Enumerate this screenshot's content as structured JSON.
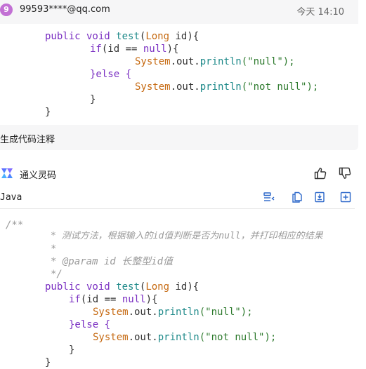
{
  "message": {
    "avatar_text": "9",
    "email": "99593****@qq.com",
    "timestamp": "今天 14:10",
    "prompt": "生成代码注释"
  },
  "assistant": {
    "name": "通义灵码"
  },
  "code_block": {
    "language": "Java"
  },
  "user_code": [
    [
      "public void ",
      "test",
      "(",
      "Long",
      " id){"
    ],
    [
      "if",
      "(id == ",
      "null",
      "){"
    ],
    [
      "System",
      ".out.",
      "println",
      "(\"null\");"
    ],
    [
      "}else {"
    ],
    [
      "System",
      ".out.",
      "println",
      "(\"not null\");"
    ],
    [
      "}"
    ],
    [
      "}"
    ]
  ],
  "answer_code": {
    "c1": "/**",
    "c2": "* 测试方法，根据输入的id值判断是否为null，并打印相应的结果",
    "c3": "*",
    "c4": "* @param id 长整型id值",
    "c5": "*/"
  },
  "colors": {
    "avatar": "#c270d4",
    "keyword": "#7a2fc2",
    "type": "#c66a12",
    "method": "#1f8a8a",
    "string": "#2d7a2d",
    "toolbar_icon": "#2a66c9"
  }
}
